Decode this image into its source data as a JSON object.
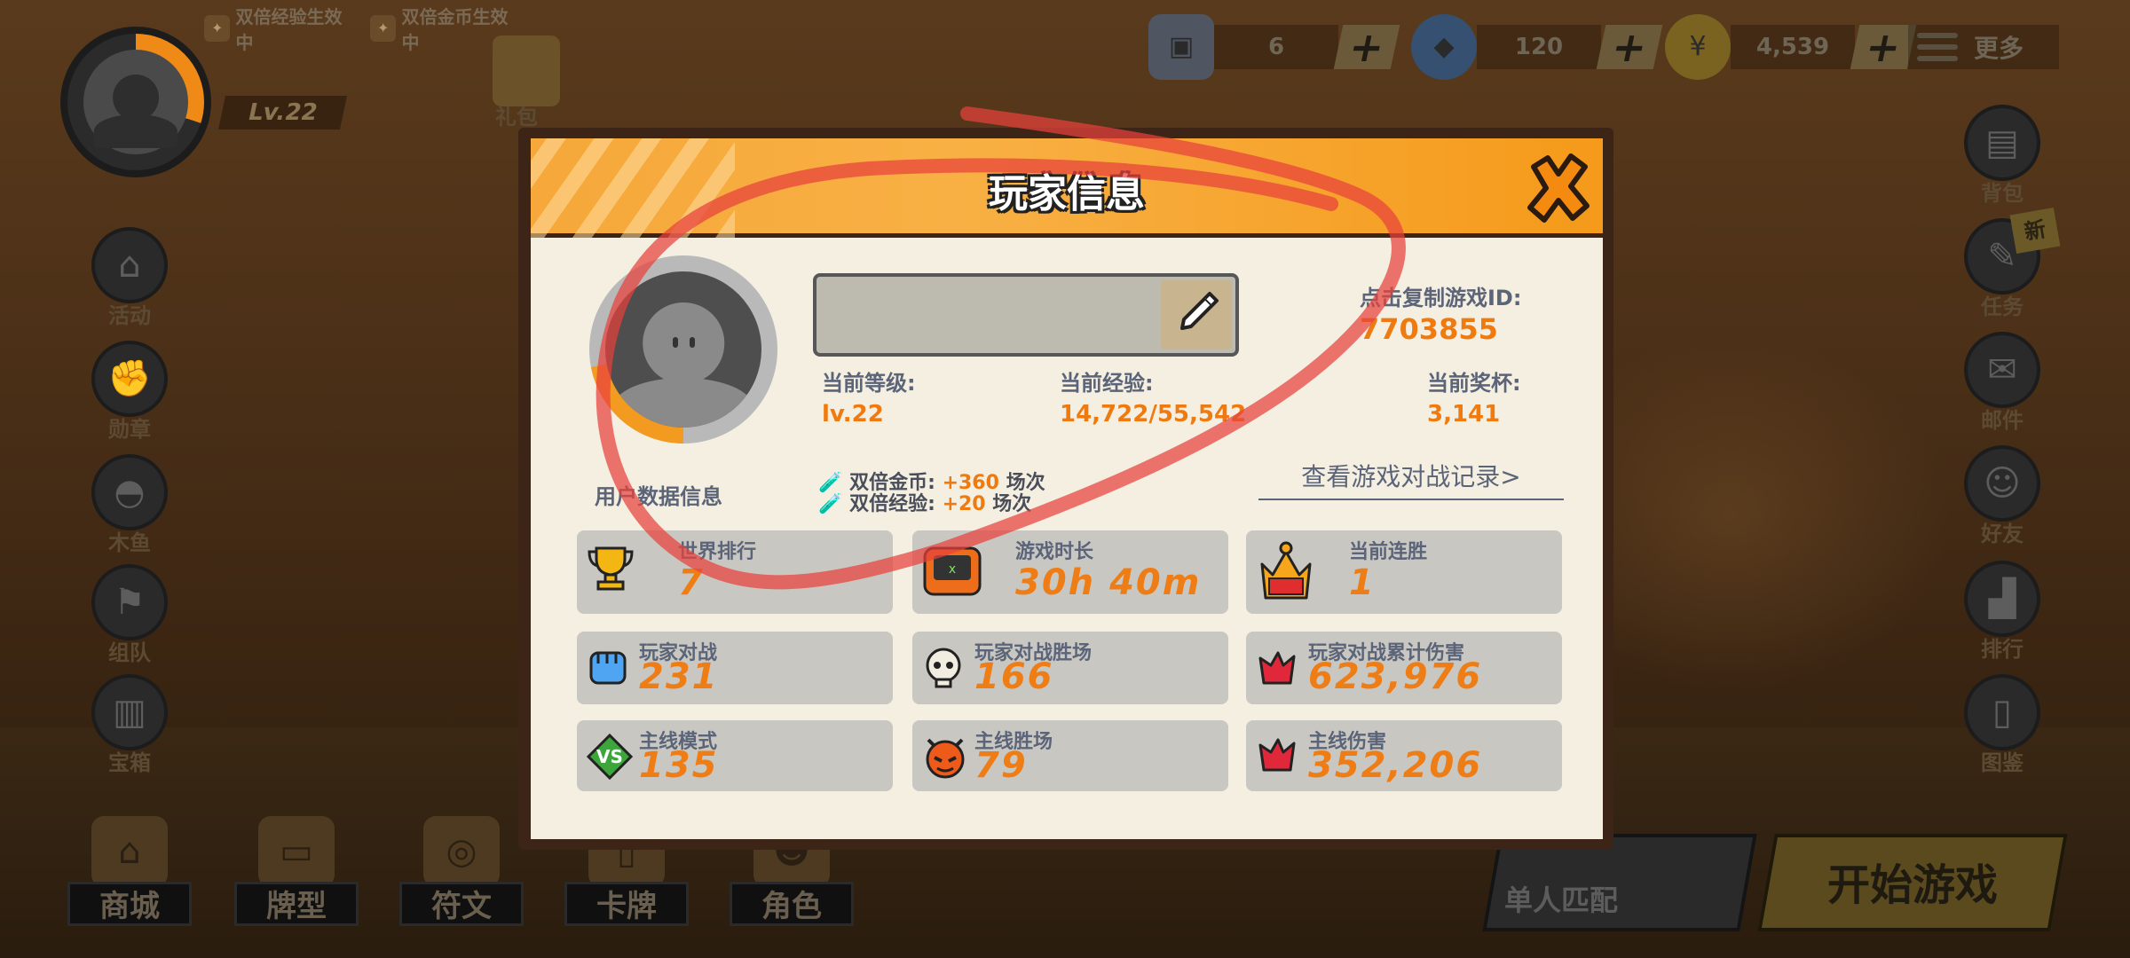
{
  "hud": {
    "level": "Lv.22",
    "buffs": [
      {
        "label": "双倍经验生效中",
        "icon": "exp-potion-icon"
      },
      {
        "label": "双倍金币生效中",
        "icon": "coin-potion-icon"
      }
    ],
    "gift_label": "礼包",
    "currencies": [
      {
        "name": "card",
        "value": "6"
      },
      {
        "name": "gem",
        "value": "120"
      },
      {
        "name": "coin",
        "value": "4,539"
      }
    ],
    "more_label": "更多"
  },
  "left_menu": [
    "活动",
    "勋章",
    "木鱼",
    "组队",
    "宝箱"
  ],
  "right_menu": {
    "items": [
      "背包",
      "任务",
      "邮件",
      "好友",
      "排行",
      "图鉴"
    ],
    "new_badge": "新"
  },
  "bottom_nav": [
    "商城",
    "牌型",
    "符文",
    "卡牌",
    "角色"
  ],
  "actions": {
    "match_label": "单人匹配",
    "start_label": "开始游戏"
  },
  "modal": {
    "title": "玩家信息",
    "copy_id_label": "点击复制游戏ID:",
    "game_id": "7703855",
    "level_label": "当前等级:",
    "level_value": "lv.22",
    "exp_label": "当前经验:",
    "exp_value": "14,722/55,542",
    "trophy_label": "当前奖杯:",
    "trophy_value": "3,141",
    "user_data_label": "用户数据信息",
    "double_coin_label": "双倍金币:",
    "double_coin_value": "+360",
    "double_exp_label": "双倍经验:",
    "double_exp_value": "+20",
    "matches_unit": "场次",
    "record_link": "查看游戏对战记录>",
    "stats": [
      {
        "label": "世界排行",
        "value": "7",
        "icon": "trophy-icon"
      },
      {
        "label": "游戏时长",
        "value": "30h 40m",
        "icon": "game-console-icon"
      },
      {
        "label": "当前连胜",
        "value": "1",
        "icon": "crown-icon"
      },
      {
        "label": "玩家对战",
        "value": "231",
        "icon": "fist-icon"
      },
      {
        "label": "玩家对战胜场",
        "value": "166",
        "icon": "skull-icon"
      },
      {
        "label": "玩家对战累计伤害",
        "value": "623,976",
        "icon": "damage-icon"
      },
      {
        "label": "主线模式",
        "value": "135",
        "icon": "vs-icon"
      },
      {
        "label": "主线胜场",
        "value": "79",
        "icon": "devil-icon"
      },
      {
        "label": "主线伤害",
        "value": "352,206",
        "icon": "damage-icon"
      }
    ]
  },
  "colors": {
    "accent_orange": "#ee7a10",
    "header_orange": "#f6a83a",
    "annotation_red": "#e8413c"
  }
}
